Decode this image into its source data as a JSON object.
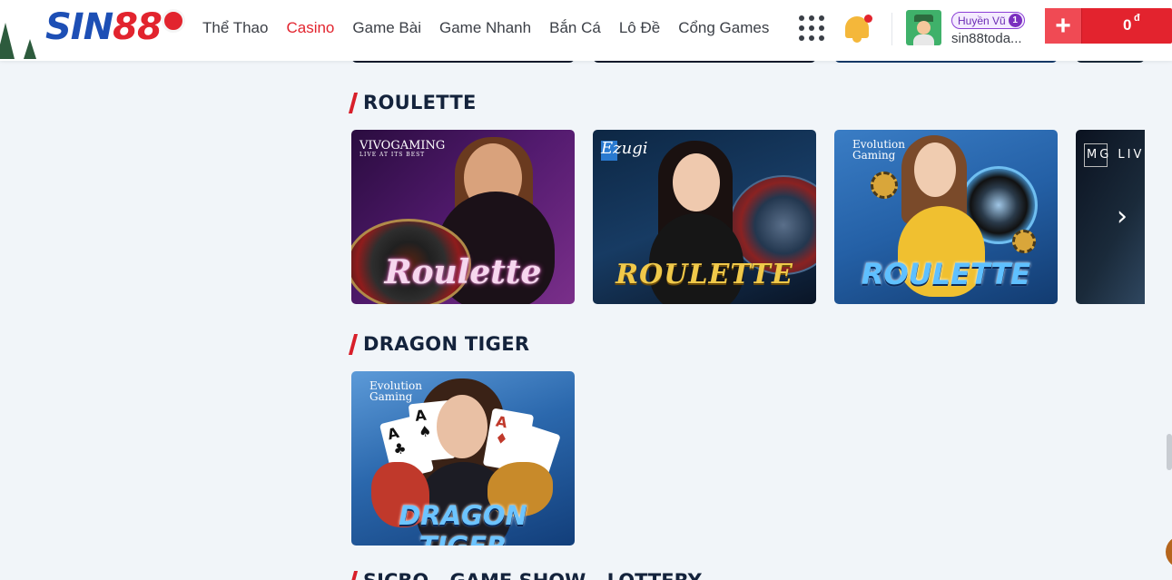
{
  "header": {
    "logo_text_1": "SIN",
    "logo_text_2": "88",
    "nav": [
      {
        "label": "Thể Thao",
        "active": false
      },
      {
        "label": "Casino",
        "active": true
      },
      {
        "label": "Game Bài",
        "active": false
      },
      {
        "label": "Game Nhanh",
        "active": false
      },
      {
        "label": "Bắn Cá",
        "active": false
      },
      {
        "label": "Lô Đề",
        "active": false
      },
      {
        "label": "Cổng Games",
        "active": false
      }
    ],
    "user": {
      "display_name": "Huyền Vũ",
      "level": "1",
      "username": "sin88toda..."
    },
    "wallet": {
      "add_symbol": "+",
      "balance": "0",
      "currency": "đ"
    }
  },
  "sections": [
    {
      "title": "ROULETTE",
      "cards": [
        {
          "provider": "VIVOGAMING",
          "provider_tagline": "LIVE AT ITS BEST",
          "game": "Roulette"
        },
        {
          "provider": "Ezugi",
          "game": "ROULETTE"
        },
        {
          "provider": "Evolution Gaming",
          "game": "ROULETTE"
        },
        {
          "provider": "MG LIV",
          "game": ""
        }
      ],
      "next_arrow": "›"
    },
    {
      "title": "DRAGON TIGER",
      "cards": [
        {
          "provider": "Evolution Gaming",
          "game": "DRAGON TIGER"
        }
      ]
    },
    {
      "title": "SICBO - GAME SHOW - LOTTERY"
    }
  ],
  "colors": {
    "accent": "#e2242e",
    "brand_blue": "#1d4fb5",
    "page_bg": "#f1f5f9",
    "section_title": "#14233c"
  }
}
